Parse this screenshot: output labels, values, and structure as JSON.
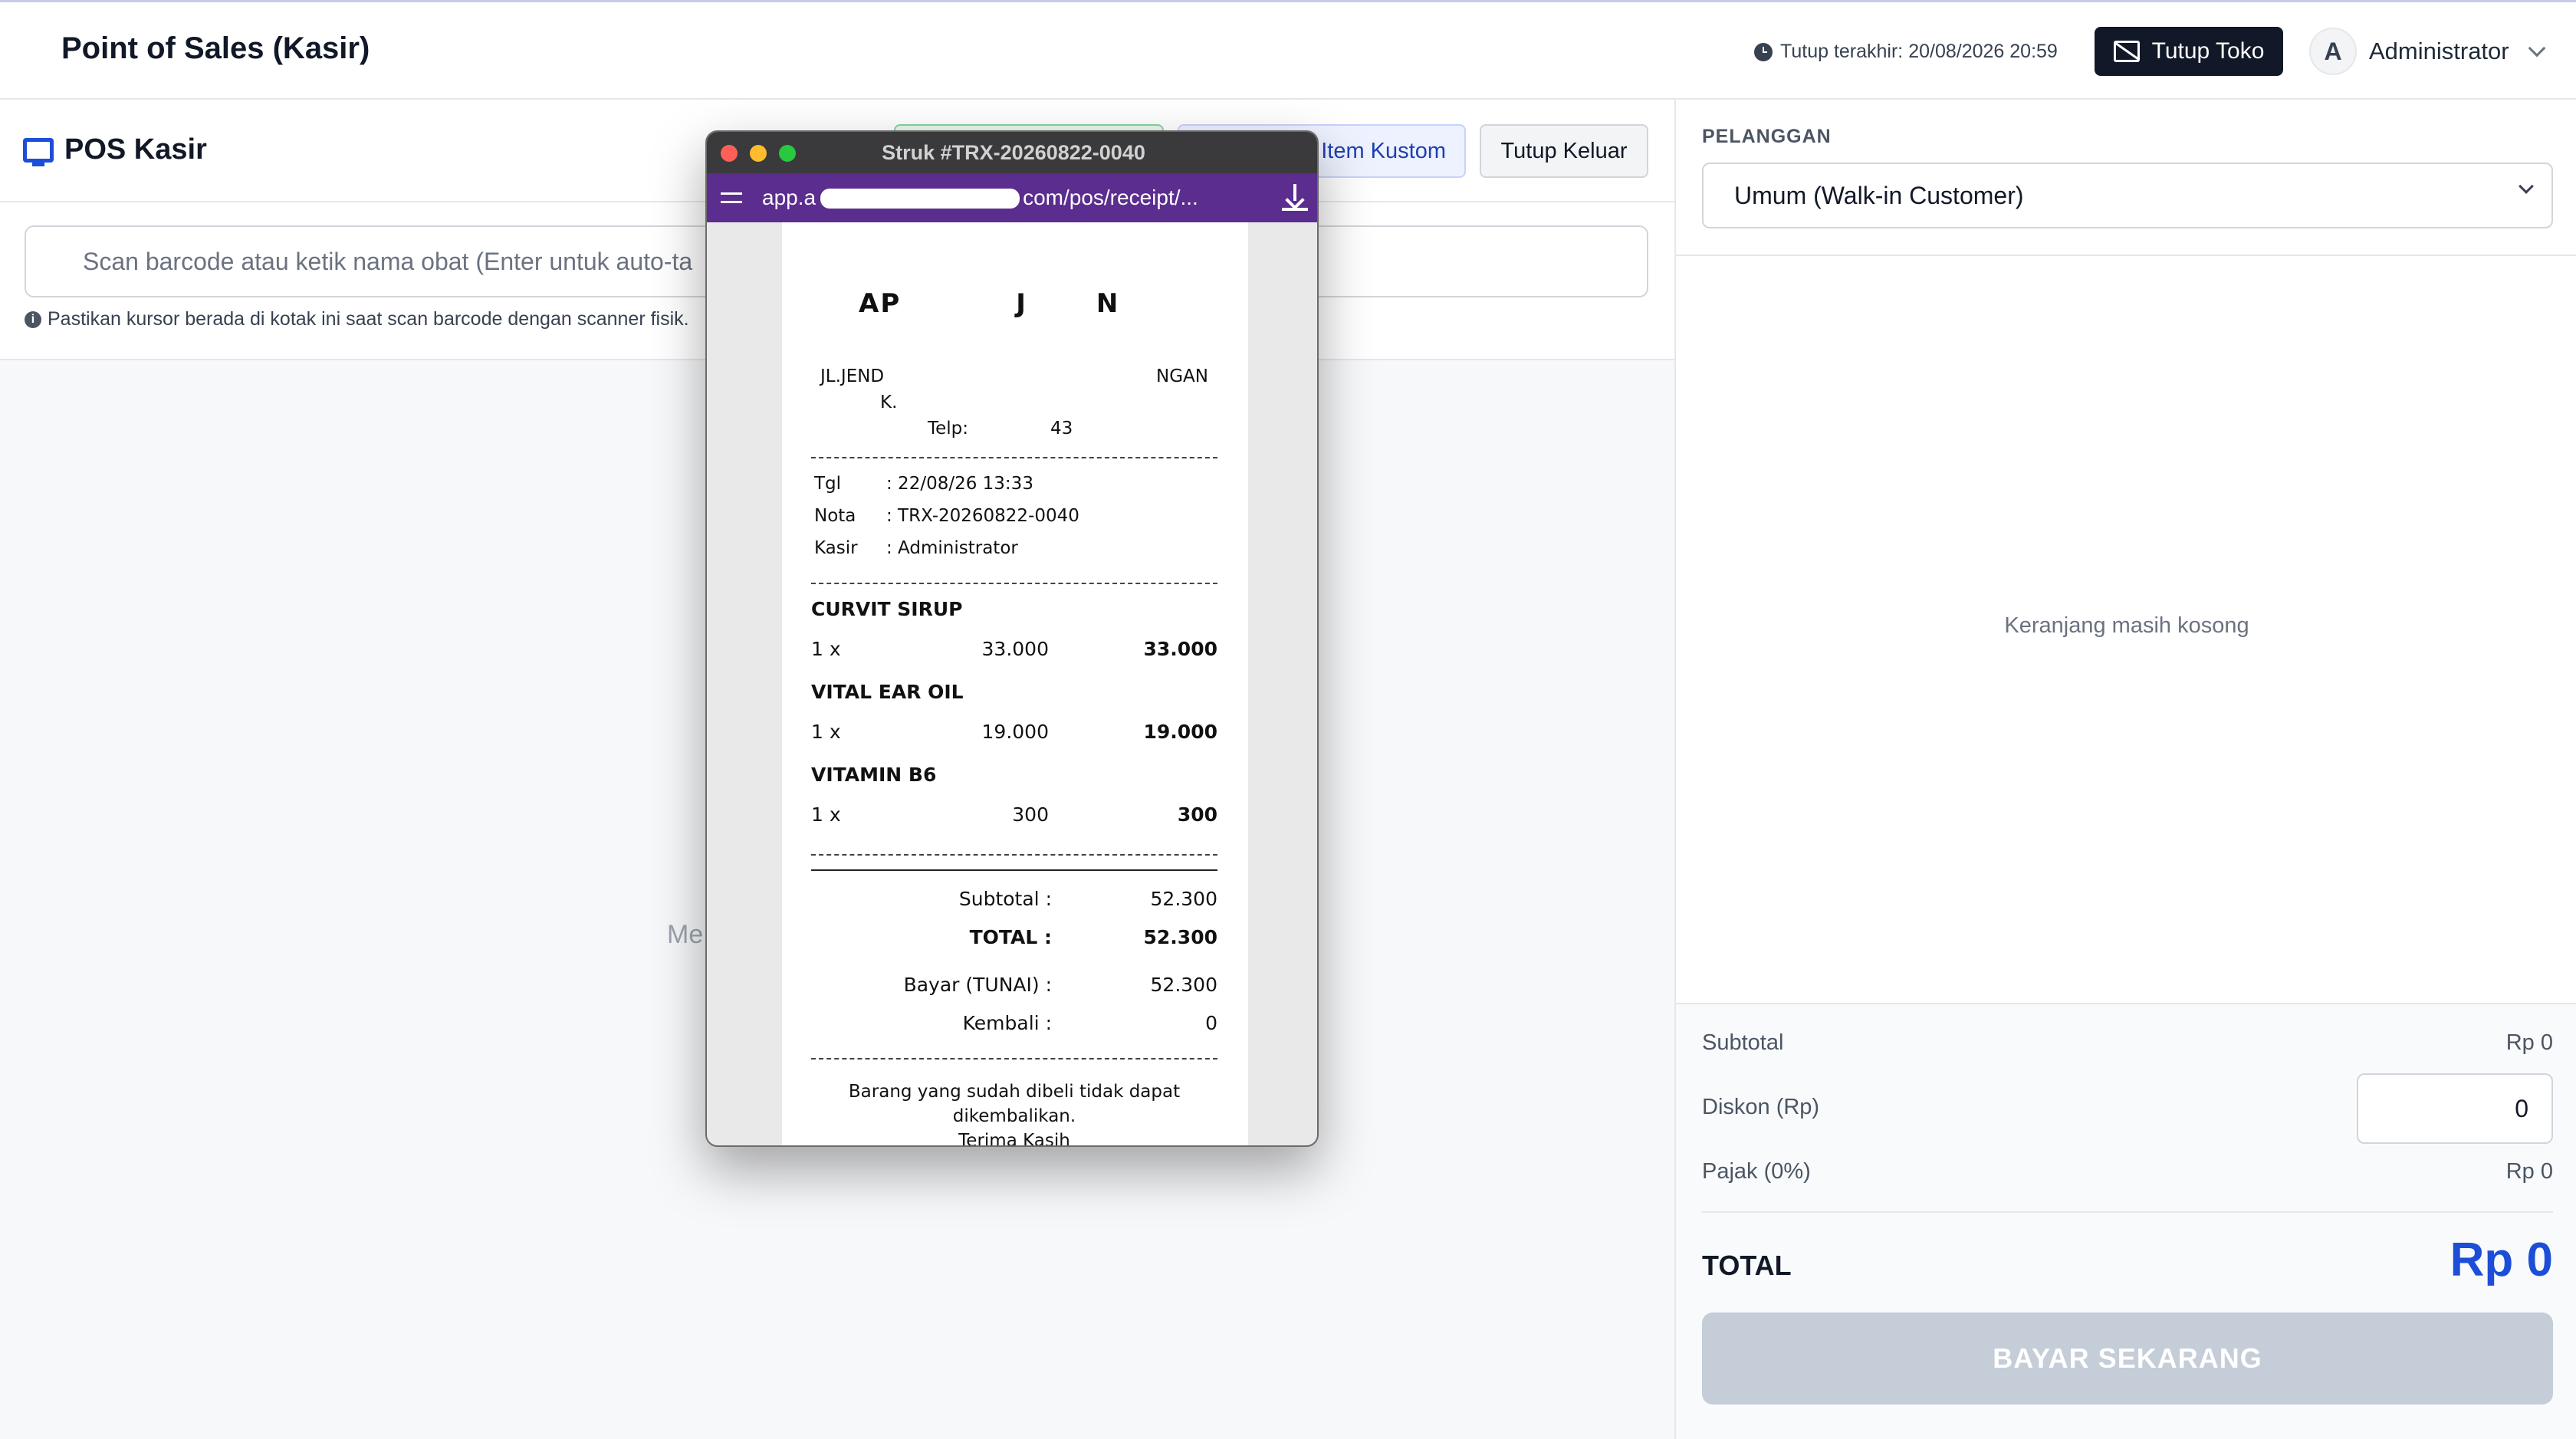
{
  "header": {
    "app_title": "Point of Sales (Kasir)",
    "last_close": "Tutup terakhir: 20/08/2026 20:59",
    "close_store_label": "Tutup Toko",
    "user_initial": "A",
    "user_name": "Administrator"
  },
  "pos": {
    "title": "POS Kasir",
    "custom_item_label": "Item Kustom",
    "exit_label": "Tutup Keluar",
    "scan_placeholder": "Scan barcode atau ketik nama obat (Enter untuk auto-ta",
    "scan_hint": "Pastikan kursor berada di kotak ini saat scan barcode dengan scanner fisik.",
    "empty_text": "Me"
  },
  "cart": {
    "customer_label": "PELANGGAN",
    "customer_value": "Umum (Walk-in Customer)",
    "empty_text": "Keranjang masih kosong",
    "subtotal_label": "Subtotal",
    "subtotal_value": "Rp 0",
    "discount_label": "Diskon (Rp)",
    "discount_value": "0",
    "tax_label": "Pajak (0%)",
    "tax_value": "Rp 0",
    "total_label": "TOTAL",
    "total_value": "Rp 0",
    "pay_label": "BAYAR SEKARANG"
  },
  "receipt_window": {
    "title": "Struk #TRX-20260822-0040",
    "url_prefix": "app.a",
    "url_suffix": "com/pos/receipt/...",
    "store_name": "AP",
    "store_name_tail": "J",
    "store_name_end": "N",
    "addr_left": "JL.JEND",
    "addr_right": "NGAN",
    "addr_line2": "K.",
    "phone_label": "Telp:",
    "phone_value": "43",
    "meta": [
      {
        "key": "Tgl",
        "value": ": 22/08/26 13:33"
      },
      {
        "key": "Nota",
        "value": ": TRX-20260822-0040"
      },
      {
        "key": "Kasir",
        "value": ": Administrator"
      }
    ],
    "items": [
      {
        "name": "CURVIT SIRUP",
        "qty": "1 x",
        "price": "33.000",
        "total": "33.000"
      },
      {
        "name": "VITAL EAR OIL",
        "qty": "1 x",
        "price": "19.000",
        "total": "19.000"
      },
      {
        "name": "VITAMIN B6",
        "qty": "1 x",
        "price": "300",
        "total": "300"
      }
    ],
    "subtotal_label": "Subtotal :",
    "subtotal_value": "52.300",
    "total_label": "TOTAL :",
    "total_value": "52.300",
    "paid_label": "Bayar (TUNAI) :",
    "paid_value": "52.300",
    "change_label": "Kembali :",
    "change_value": "0",
    "footer_line1": "Barang yang sudah dibeli tidak dapat",
    "footer_line2": "dikembalikan.",
    "footer_line3": "Terima Kasih"
  }
}
